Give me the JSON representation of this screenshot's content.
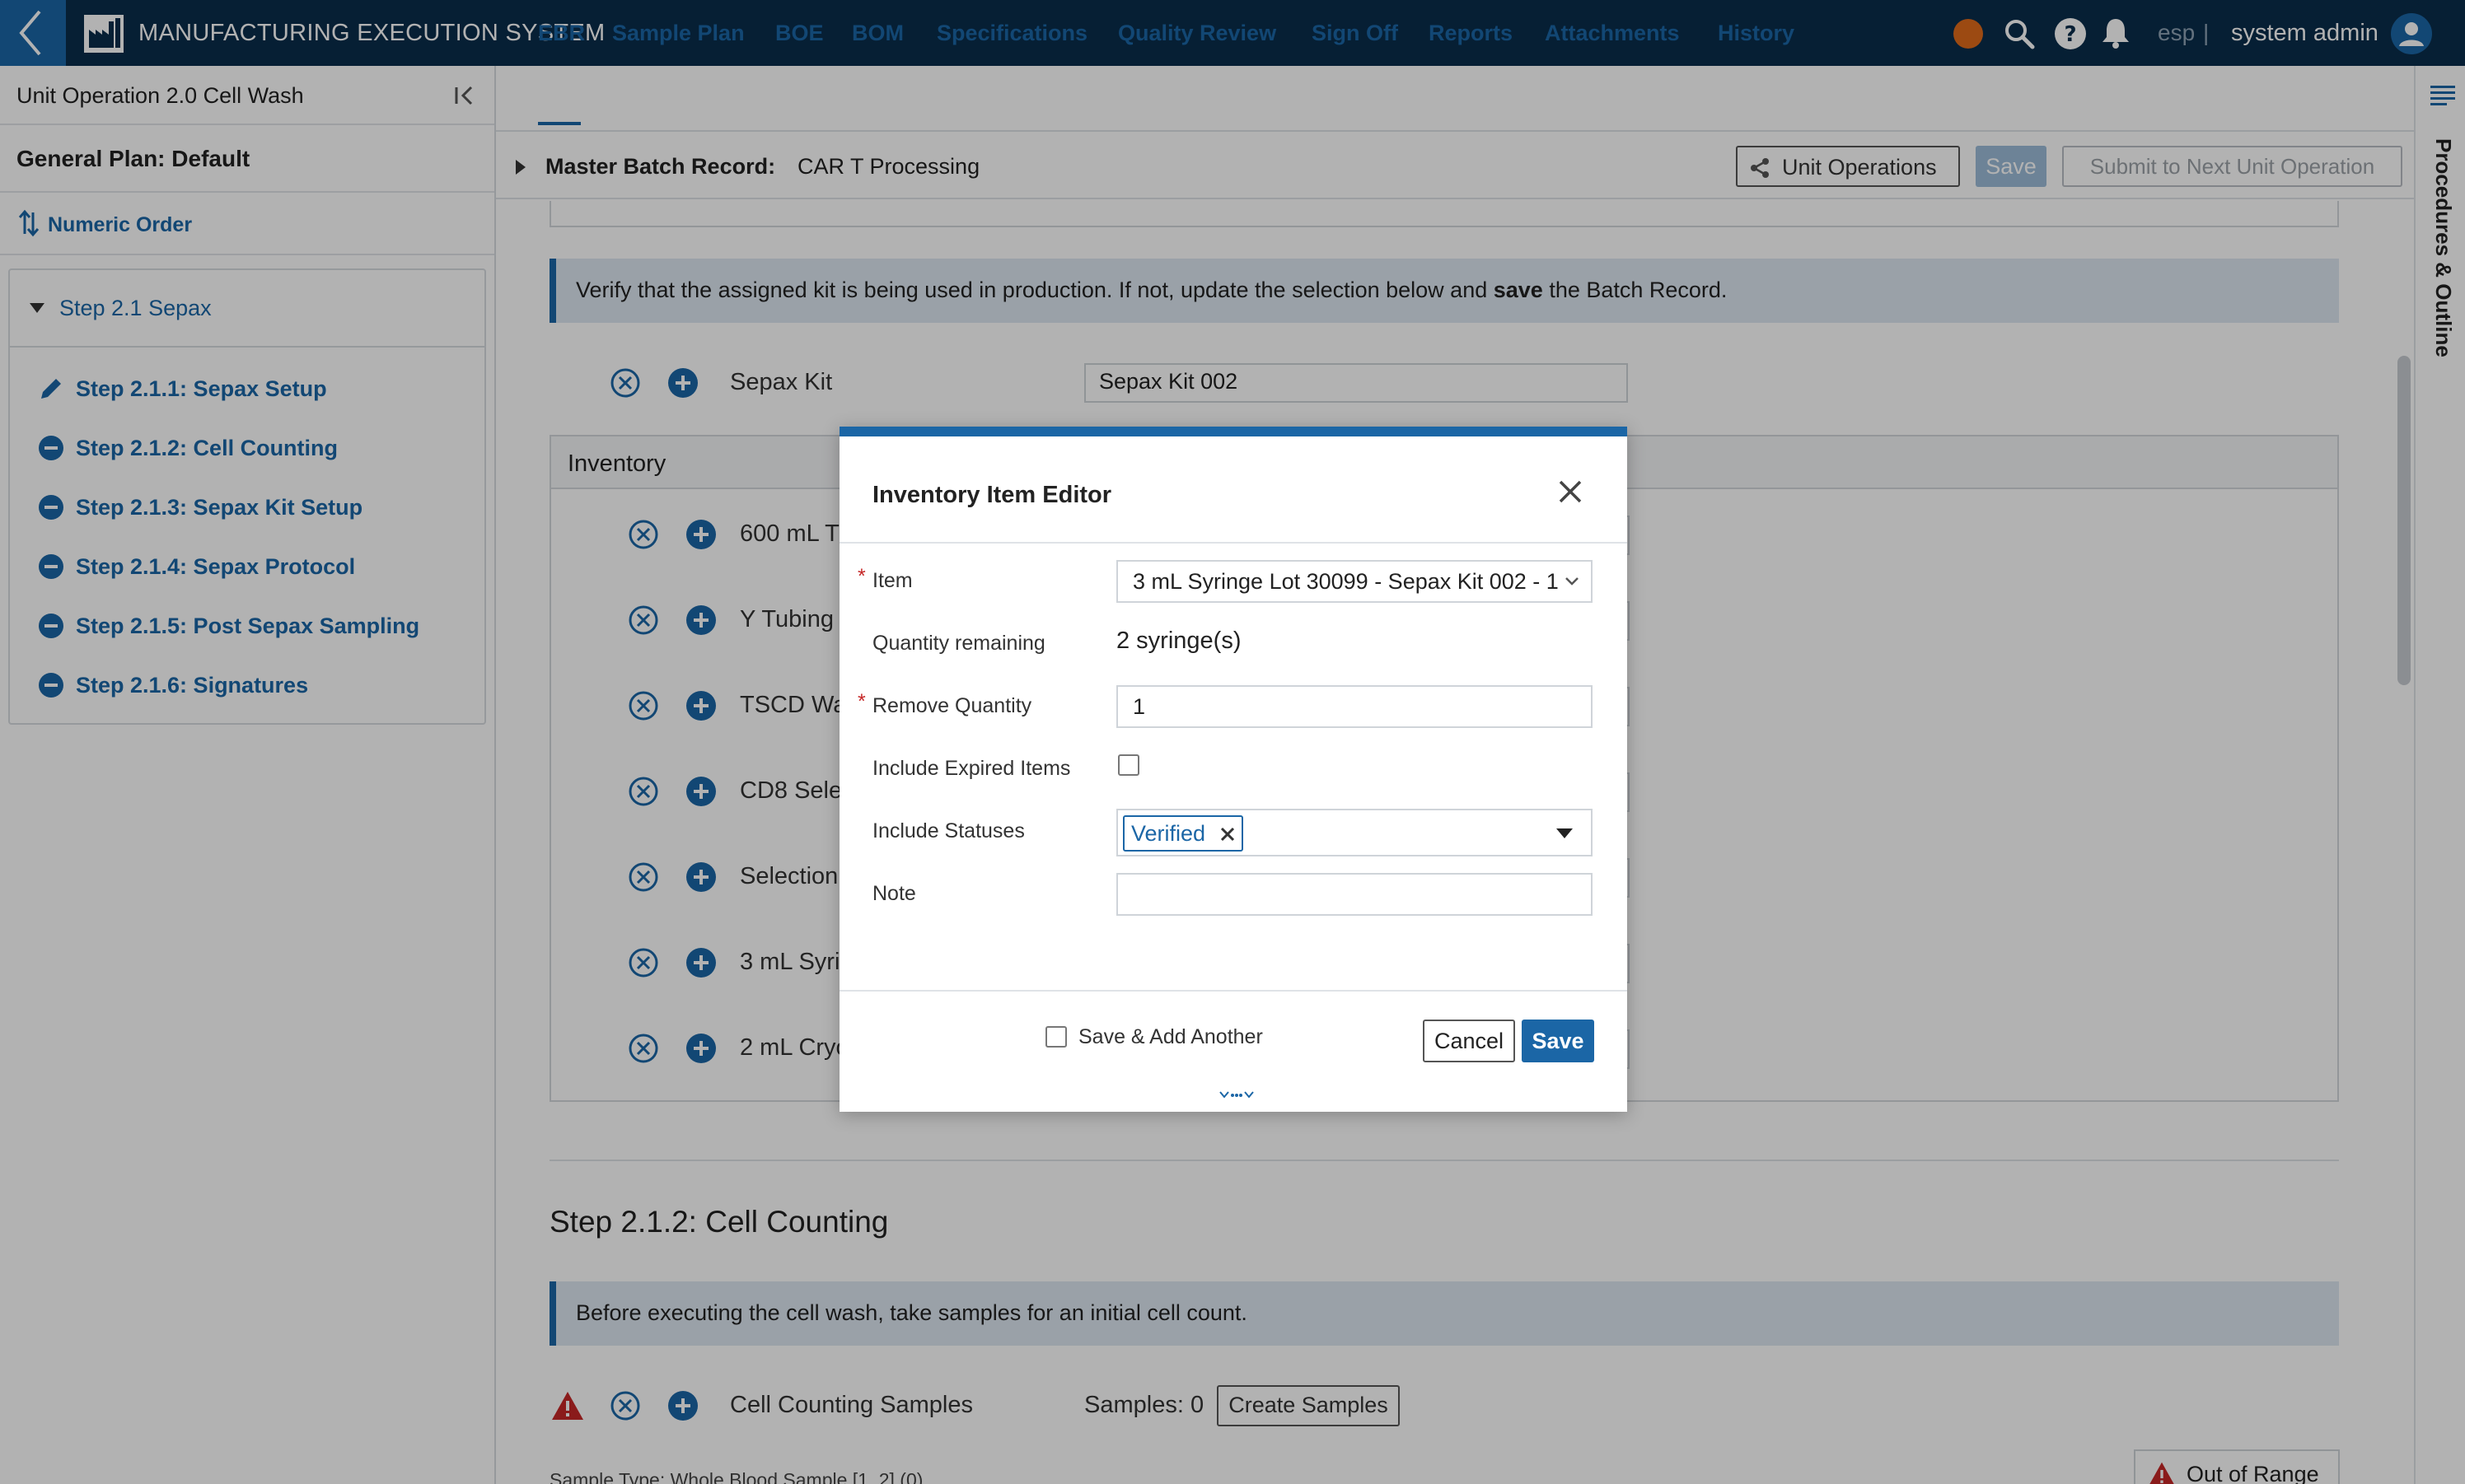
{
  "header": {
    "app_title": "MANUFACTURING EXECUTION SYSTEM",
    "lang": "esp",
    "separator": "|",
    "user": "system admin",
    "status_color": "#e06a1b"
  },
  "sidebar": {
    "unit_operation": "Unit Operation 2.0 Cell Wash",
    "plan": "General Plan: Default",
    "order_label": "Numeric Order",
    "step_group": "Step 2.1 Sepax",
    "steps": [
      {
        "label": "Step 2.1.1: Sepax Setup",
        "icon": "pencil-icon"
      },
      {
        "label": "Step 2.1.2: Cell Counting",
        "icon": "minus-circle-icon"
      },
      {
        "label": "Step 2.1.3: Sepax Kit Setup",
        "icon": "minus-circle-icon"
      },
      {
        "label": "Step 2.1.4: Sepax Protocol",
        "icon": "minus-circle-icon"
      },
      {
        "label": "Step 2.1.5: Post Sepax Sampling",
        "icon": "minus-circle-icon"
      },
      {
        "label": "Step 2.1.6: Signatures",
        "icon": "minus-circle-icon"
      }
    ]
  },
  "tabs": [
    "EBR",
    "Sample Plan",
    "BOE",
    "BOM",
    "Specifications",
    "Quality Review",
    "Sign Off",
    "Reports",
    "Attachments",
    "History"
  ],
  "record": {
    "label": "Master Batch Record:",
    "value": "CAR T Processing",
    "unit_ops_button": "Unit Operations",
    "save_button": "Save",
    "submit_button": "Submit to Next Unit Operation"
  },
  "right_rail": {
    "label": "Procedures & Outline"
  },
  "content": {
    "verify_banner_pre": "Verify that the assigned kit is being used in production. If not, update the selection below and ",
    "verify_banner_bold": "save",
    "verify_banner_post": " the Batch Record.",
    "kit_label": "Sepax Kit",
    "kit_value": "Sepax Kit 002",
    "inventory_title": "Inventory",
    "inventory_rows": [
      "600 mL T",
      "Y Tubing",
      "TSCD Wa",
      "CD8 Selec",
      "Selection",
      "3 mL Syri",
      "2 mL Cryo"
    ],
    "step_title": "Step 2.1.2: Cell Counting",
    "cell_banner": "Before executing the cell wash, take samples for an initial cell count.",
    "samples_label": "Cell Counting Samples",
    "samples_count": "Samples: 0",
    "create_samples": "Create Samples",
    "out_of_range": "Out of Range",
    "sample_type": "Sample Type: Whole Blood Sample [1, 2] (0)"
  },
  "modal": {
    "title": "Inventory Item Editor",
    "item_label": "Item",
    "item_value": "3 mL Syringe Lot 30099 - Sepax Kit 002 - 1",
    "qty_remaining_label": "Quantity remaining",
    "qty_remaining_value": "2 syringe(s)",
    "remove_qty_label": "Remove Quantity",
    "remove_qty_value": "1",
    "include_expired_label": "Include Expired Items",
    "include_statuses_label": "Include Statuses",
    "status_chip": "Verified",
    "note_label": "Note",
    "save_add_label": "Save & Add Another",
    "cancel": "Cancel",
    "save": "Save"
  },
  "colors": {
    "primary": "#1b66a6",
    "header_bg": "#0a2d4b",
    "warning": "#c62828"
  }
}
